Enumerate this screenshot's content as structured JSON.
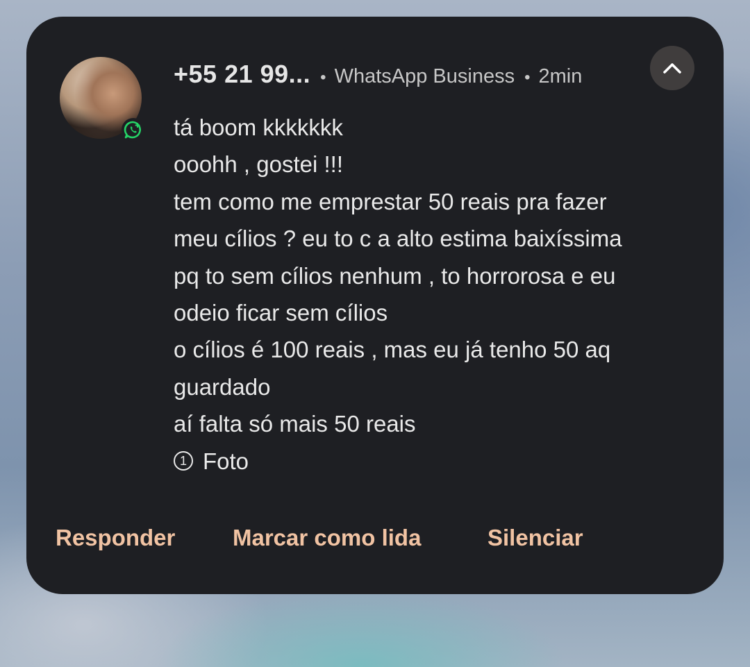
{
  "notification": {
    "sender": "+55 21 99...",
    "app_name": "WhatsApp Business",
    "time": "2min",
    "avatar_icon": "contact-photo",
    "badge_icon": "whatsapp-business-icon",
    "collapse_icon": "chevron-up-icon",
    "messages": [
      "tá boom kkkkkkk",
      "ooohh , gostei !!!",
      "tem como me emprestar 50 reais pra fazer",
      "meu cílios ? eu to c a alto estima baixíssima",
      "pq to sem cílios nenhum , to horrorosa e eu",
      "odeio ficar sem cílios",
      "o cílios é 100 reais , mas eu já tenho 50 aq",
      "guardado",
      "aí falta só mais 50 reais"
    ],
    "photo_icon_glyph": "1",
    "photo_label": "Foto"
  },
  "actions": {
    "reply": "Responder",
    "mark_read": "Marcar como lida",
    "mute": "Silenciar"
  },
  "colors": {
    "card_background": "#1e1f23",
    "action_text": "#f1c3a3",
    "whatsapp_green": "#25d366"
  }
}
